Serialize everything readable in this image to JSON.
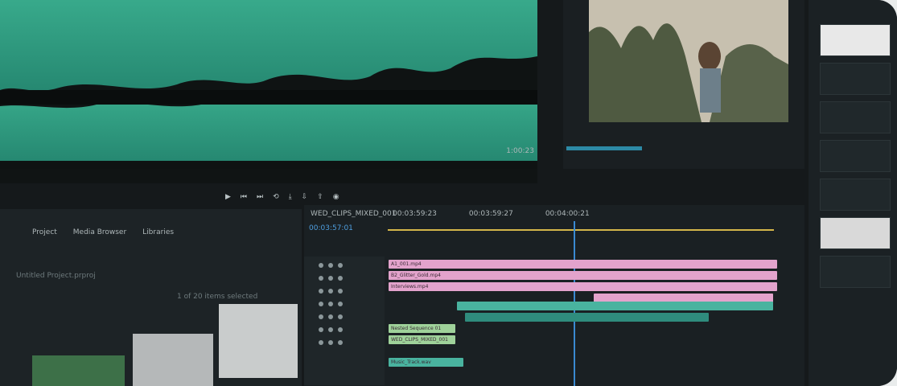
{
  "audio_panel": {
    "timecode": "1:00:23"
  },
  "transport": {
    "icons": [
      "play-icon",
      "step-back-icon",
      "step-forward-icon",
      "loop-icon",
      "insert-icon",
      "overwrite-icon",
      "lift-icon",
      "extract-icon",
      "export-frame-icon",
      "camera-icon"
    ]
  },
  "timeline": {
    "sequence_name": "WED_CLIPS_MIXED_001",
    "current_time": "00:03:57:01",
    "ruler": [
      "00:03:59:23",
      "00:03:59:27",
      "00:04:00:21"
    ],
    "clips": [
      {
        "label": "A1_001.mp4",
        "color": "pink"
      },
      {
        "label": "B2_Glitter_Gold.mp4",
        "color": "pink"
      },
      {
        "label": "Interviews.mp4",
        "color": "pink"
      },
      {
        "label": "Nested Sequence 01",
        "color": "green"
      },
      {
        "label": "WED_CLIPS_MIXED_001",
        "color": "green"
      },
      {
        "label": "Music_Track.wav",
        "color": "teal"
      }
    ]
  },
  "project": {
    "tabs": [
      "Project",
      "Media Browser",
      "Libraries"
    ],
    "info": "Untitled Project.prproj",
    "status": "1 of 20 items selected"
  },
  "colors": {
    "waveform": "#3fc4a0",
    "clip_pink": "#e3a3cc",
    "clip_teal": "#49b39f",
    "clip_green": "#9fd29a",
    "playhead": "#3a8ad1"
  }
}
